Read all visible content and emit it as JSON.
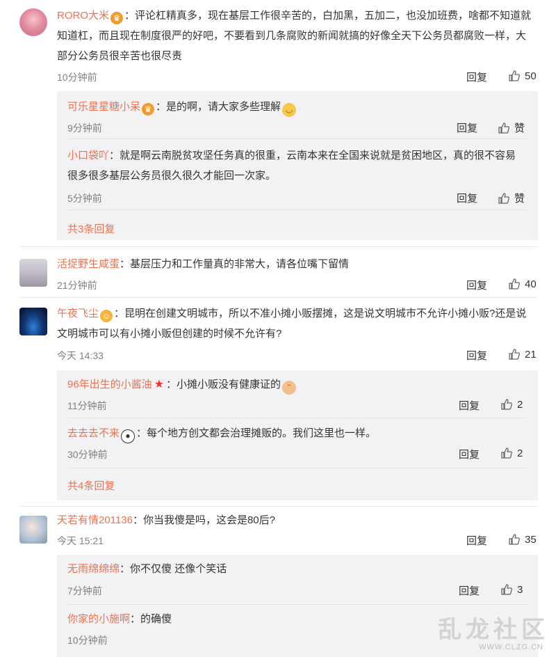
{
  "comments": [
    {
      "user": "RORO大米",
      "text": "评论杠精真多，现在基层工作很辛苦的，白加黑，五加二，也没加班费，啥都不知道就知道杠，而且现在制度很严的好吧，不要看到几条腐败的新闻就搞的好像全天下公务员都腐败一样，大部分公务员很辛苦也很尽责",
      "time": "10分钟前",
      "reply": "回复",
      "likes": "50",
      "replies": [
        {
          "user": "可乐星星糖小呆",
          "text": "是的啊，请大家多些理解",
          "time": "9分钟前",
          "reply": "回复",
          "likes": "赞"
        },
        {
          "user": "小口袋吖",
          "text": "就是啊云南脱贫攻坚任务真的很重，云南本来在全国来说就是贫困地区，真的很不容易很多很多基层公务员很久很久才能回一次家。",
          "time": "5分钟前",
          "reply": "回复",
          "likes": "赞"
        }
      ],
      "more": "共3条回复"
    },
    {
      "user": "活捉野生咸蛋",
      "text": "基层压力和工作量真的非常大，请各位嘴下留情",
      "time": "21分钟前",
      "reply": "回复",
      "likes": "40"
    },
    {
      "user": "午夜飞尘",
      "text": "昆明在创建文明城市，所以不准小摊小贩摆摊，这是说文明城市不允许小摊小贩?还是说文明城市可以有小摊小贩但创建的时候不允许有?",
      "time": "今天 14:33",
      "reply": "回复",
      "likes": "21",
      "replies": [
        {
          "user": "96年出生的小酱油",
          "text": "小摊小贩没有健康证的",
          "time": "11分钟前",
          "reply": "回复",
          "likes": "2"
        },
        {
          "user": "去去去不来",
          "text": "每个地方创文都会治理摊贩的。我们这里也一样。",
          "time": "30分钟前",
          "reply": "回复",
          "likes": "2"
        }
      ],
      "more": "共4条回复"
    },
    {
      "user": "天若有情201136",
      "text": "你当我傻是吗，这会是80后?",
      "time": "今天 15:21",
      "reply": "回复",
      "likes": "35",
      "replies": [
        {
          "user": "无雨绵绵绵",
          "text": "你不仅傻 还像个笑话",
          "time": "7分钟前",
          "reply": "回复",
          "likes": "3"
        },
        {
          "user": "你家的小施啊",
          "text": "的确傻",
          "time": "10分钟前"
        }
      ]
    }
  ],
  "watermark": {
    "text": "乱龙社区",
    "url": "WWW.CLZG.CN"
  },
  "colors": {
    "username": "#eb7350",
    "subBox": "#f2f2f5",
    "meta": "#808080"
  }
}
